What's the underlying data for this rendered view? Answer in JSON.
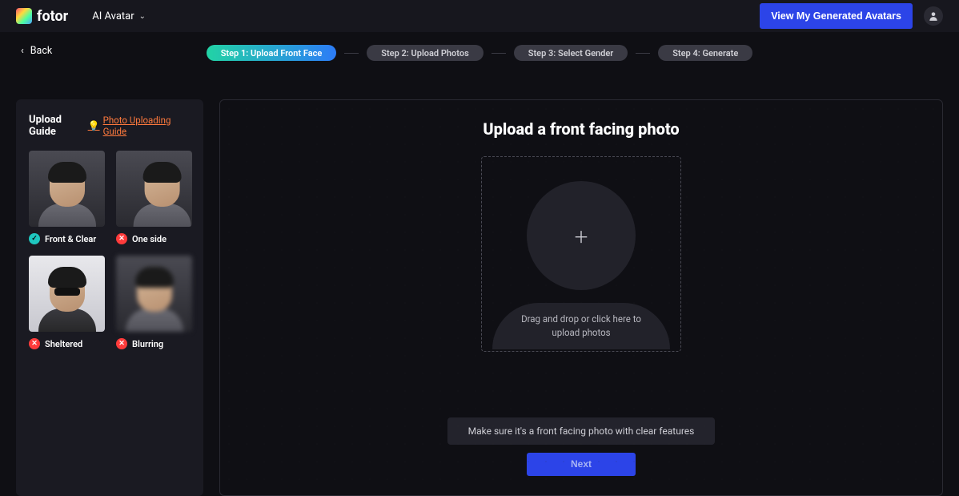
{
  "header": {
    "brand": "fotor",
    "menu_label": "AI Avatar",
    "view_avatars_label": "View My Generated Avatars"
  },
  "nav": {
    "back_label": "Back"
  },
  "steps": [
    {
      "label": "Step 1: Upload Front Face",
      "active": true
    },
    {
      "label": "Step 2: Upload Photos",
      "active": false
    },
    {
      "label": "Step 3: Select Gender",
      "active": false
    },
    {
      "label": "Step 4: Generate",
      "active": false
    }
  ],
  "sidebar": {
    "title": "Upload Guide",
    "link_label": "Photo Uploading Guide",
    "items": [
      {
        "label": "Front & Clear",
        "status": "good"
      },
      {
        "label": "One side",
        "status": "bad"
      },
      {
        "label": "Sheltered",
        "status": "bad"
      },
      {
        "label": "Blurring",
        "status": "bad"
      }
    ]
  },
  "content": {
    "title": "Upload a front facing photo",
    "upload_hint": "Drag and drop or click here to upload photos",
    "banner_text": "Make sure it's a front facing photo with clear features",
    "next_label": "Next"
  }
}
